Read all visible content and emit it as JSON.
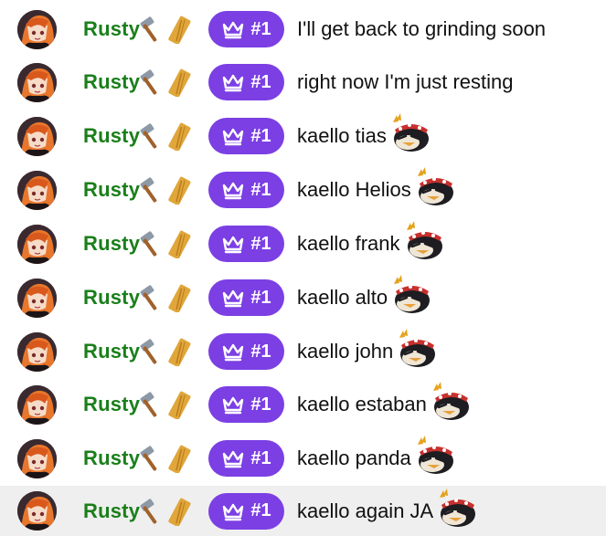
{
  "chat": {
    "messages": [
      {
        "username": "Rusty",
        "badge_text": "#1",
        "text": "I'll get back to grinding soon",
        "emote": "",
        "highlighted": false
      },
      {
        "username": "Rusty",
        "badge_text": "#1",
        "text": "right now I'm just resting",
        "emote": "",
        "highlighted": false
      },
      {
        "username": "Rusty",
        "badge_text": "#1",
        "text": "kaello tias",
        "emote": "penguin-emote",
        "highlighted": false
      },
      {
        "username": "Rusty",
        "badge_text": "#1",
        "text": "kaello Helios",
        "emote": "penguin-emote",
        "highlighted": false
      },
      {
        "username": "Rusty",
        "badge_text": "#1",
        "text": "kaello frank",
        "emote": "penguin-emote",
        "highlighted": false
      },
      {
        "username": "Rusty",
        "badge_text": "#1",
        "text": "kaello alto",
        "emote": "penguin-emote",
        "highlighted": false
      },
      {
        "username": "Rusty",
        "badge_text": "#1",
        "text": "kaello john",
        "emote": "penguin-emote",
        "highlighted": false
      },
      {
        "username": "Rusty",
        "badge_text": "#1",
        "text": "kaello estaban",
        "emote": "penguin-emote",
        "highlighted": false
      },
      {
        "username": "Rusty",
        "badge_text": "#1",
        "text": "kaello panda",
        "emote": "penguin-emote",
        "highlighted": false
      },
      {
        "username": "Rusty",
        "badge_text": "#1",
        "text": "kaello again JA",
        "emote": "penguin-emote",
        "highlighted": true
      }
    ]
  },
  "colors": {
    "username": "#1a7f1a",
    "badge": "#7b3fe4",
    "highlight_row": "#efefef",
    "message_text": "#111111"
  },
  "icons": {
    "user_tools": [
      "hammer-icon",
      "plank-icon"
    ],
    "badge": "crown-icon"
  }
}
